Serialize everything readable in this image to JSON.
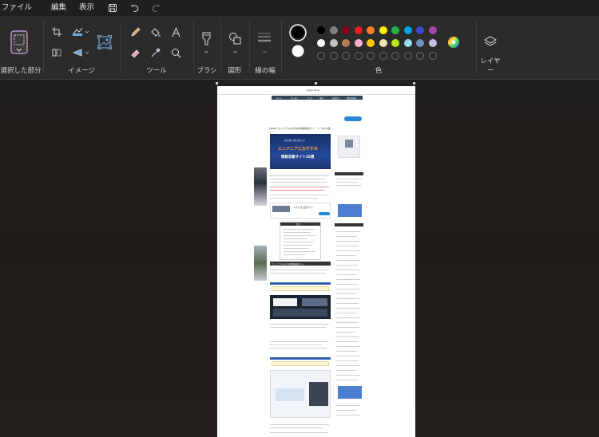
{
  "menu": {
    "file": "ファイル",
    "edit": "編集",
    "view": "表示"
  },
  "ribbon": {
    "selection_label": "選択した部分",
    "image_label": "イメージ",
    "tools_label": "ツール",
    "brush_label": "ブラシ",
    "shapes_label": "図形",
    "line_width_label": "線の幅",
    "colors_label": "色",
    "layers_label": "レイヤー"
  },
  "colors": {
    "primary": "#000000",
    "secondary": "#ffffff",
    "palette_row1": [
      "#000000",
      "#7f7f7f",
      "#88001b",
      "#ec1c24",
      "#ff7f27",
      "#fff200",
      "#22b14c",
      "#00a2e8",
      "#3f48cc",
      "#a349a4"
    ],
    "palette_row2": [
      "#ffffff",
      "#c3c3c3",
      "#b97a57",
      "#ffaec9",
      "#ffc90e",
      "#efe4b0",
      "#b5e61d",
      "#99d9ea",
      "#7092be",
      "#c8bfe7"
    ]
  },
  "canvas_content": {
    "site_logo": "gihyo.blog",
    "nav_items": [
      "ホーム",
      "はじめに",
      "ブログ",
      "技術",
      "お問合せ",
      "運営者情報"
    ],
    "header_text": "エトムスツリー6200・3P1",
    "article_title": "【2024】エンジニアにおすすめの情報収集サイト・ツールを10選",
    "banner_line1": "初心者～初心者にも！",
    "banner_line2": "エンジニアにおすすめ",
    "banner_line3": "情報収集サイト10選",
    "ad_text": "ドスパラ公式サイト",
    "toc_heading": "目次",
    "section_heading": "エンジニアにおすすめ情報収集サイト"
  }
}
